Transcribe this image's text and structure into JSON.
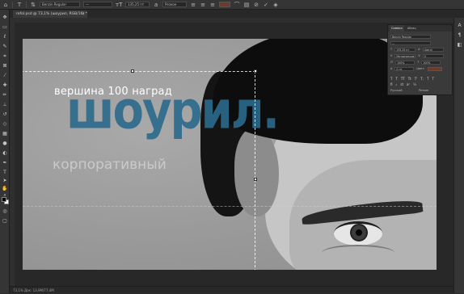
{
  "options_bar": {
    "font_family": "Benzin Regular",
    "font_style": "—",
    "font_size": "135,25 пт",
    "antialias": "Резкое"
  },
  "document": {
    "tab_title": "refol.psd @ 73,1% (шоурил, RGB/16) *",
    "tab_close": "×"
  },
  "canvas": {
    "text_top": "вершина 100 наград",
    "text_big": "шоурил.",
    "text_sub": "корпоративный"
  },
  "character_panel": {
    "tabs": [
      "Символ",
      "Абзац"
    ],
    "font_family": "Benzin Regular",
    "font_style": "—",
    "font_size": "135,25 пт",
    "leading": "(Авто)",
    "kerning": "Метрические",
    "tracking": "0",
    "vscale": "100%",
    "hscale": "100%",
    "baseline": "0 пт",
    "color_label": "Цвет:",
    "language": "Русский",
    "aa": "Резкое",
    "accent_color": "#6e3a2a"
  },
  "status": {
    "text": "73,1%   Док: 13,9M/77,4M"
  }
}
